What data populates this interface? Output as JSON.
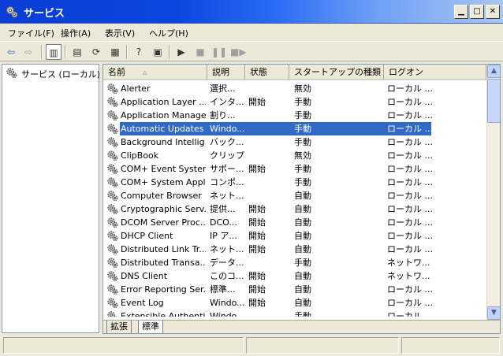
{
  "window": {
    "title": "サービス"
  },
  "menu": [
    "ファイル(F)",
    "操作(A)",
    "表示(V)",
    "ヘルプ(H)"
  ],
  "tree": {
    "root_label": "サービス (ローカル)"
  },
  "columns": [
    "名前",
    "説明",
    "状態",
    "スタートアップの種類",
    "ログオン"
  ],
  "services": [
    {
      "name": "Alerter",
      "desc": "選択...",
      "status": "",
      "startup": "無効",
      "logon": "ローカル ..."
    },
    {
      "name": "Application Layer ...",
      "desc": "インタ...",
      "status": "開始",
      "startup": "手動",
      "logon": "ローカル ..."
    },
    {
      "name": "Application Manage...",
      "desc": "割り...",
      "status": "",
      "startup": "手動",
      "logon": "ローカル ..."
    },
    {
      "name": "Automatic Updates",
      "desc": "Windo...",
      "status": "",
      "startup": "手動",
      "logon": "ローカル ..."
    },
    {
      "name": "Background Intellig...",
      "desc": "バック...",
      "status": "",
      "startup": "手動",
      "logon": "ローカル ..."
    },
    {
      "name": "ClipBook",
      "desc": "クリップ...",
      "status": "",
      "startup": "無効",
      "logon": "ローカル ..."
    },
    {
      "name": "COM+ Event System",
      "desc": "サポー...",
      "status": "開始",
      "startup": "手動",
      "logon": "ローカル ..."
    },
    {
      "name": "COM+ System Appl...",
      "desc": "コンポ...",
      "status": "",
      "startup": "手動",
      "logon": "ローカル ..."
    },
    {
      "name": "Computer Browser",
      "desc": "ネット...",
      "status": "",
      "startup": "自動",
      "logon": "ローカル ..."
    },
    {
      "name": "Cryptographic Serv...",
      "desc": "提供...",
      "status": "開始",
      "startup": "自動",
      "logon": "ローカル ..."
    },
    {
      "name": "DCOM Server Proc...",
      "desc": "DCO...",
      "status": "開始",
      "startup": "自動",
      "logon": "ローカル ..."
    },
    {
      "name": "DHCP Client",
      "desc": "IP ア...",
      "status": "開始",
      "startup": "自動",
      "logon": "ローカル ..."
    },
    {
      "name": "Distributed Link Tr...",
      "desc": "ネット...",
      "status": "開始",
      "startup": "自動",
      "logon": "ローカル ..."
    },
    {
      "name": "Distributed Transa...",
      "desc": "データ...",
      "status": "",
      "startup": "手動",
      "logon": "ネットワ..."
    },
    {
      "name": "DNS Client",
      "desc": "このコ...",
      "status": "開始",
      "startup": "自動",
      "logon": "ネットワ..."
    },
    {
      "name": "Error Reporting Ser...",
      "desc": "標準...",
      "status": "開始",
      "startup": "自動",
      "logon": "ローカル ..."
    },
    {
      "name": "Event Log",
      "desc": "Windo...",
      "status": "開始",
      "startup": "自動",
      "logon": "ローカル ..."
    },
    {
      "name": "Extensible Authenti...",
      "desc": "Windo...",
      "status": "",
      "startup": "手動",
      "logon": "ローカル ..."
    }
  ],
  "tabs": [
    "拡張",
    "標準"
  ],
  "selected_service": "Automatic Updates",
  "colors": {
    "title_start": "#0a3ed4",
    "selection": "#316ac5",
    "window_face": "#ece9d8"
  }
}
